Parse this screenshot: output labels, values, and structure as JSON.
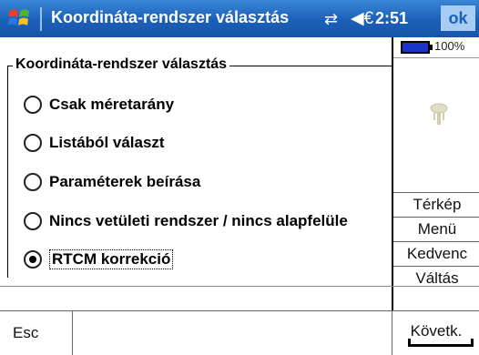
{
  "titlebar": {
    "title": "Koordináta-rendszer választás",
    "time": "2:51",
    "ok_label": "ok",
    "conn_icon": "⇄",
    "vol_icon": "◀€"
  },
  "status": {
    "battery_percent": "100%"
  },
  "group": {
    "title": "Koordináta-rendszer választás",
    "options": [
      {
        "label": "Csak méretarány",
        "selected": false
      },
      {
        "label": "Listából választ",
        "selected": false
      },
      {
        "label": "Paraméterek beírása",
        "selected": false
      },
      {
        "label": "Nincs vetületi rendszer / nincs alapfelüle",
        "selected": false
      },
      {
        "label": "RTCM korrekció",
        "selected": true
      }
    ]
  },
  "sidebar": {
    "buttons": [
      "Térkép",
      "Menü",
      "Kedvenc",
      "Váltás"
    ]
  },
  "bottom": {
    "left_label": "Esc",
    "right_label": "Követk."
  },
  "colors": {
    "titlebar": "#1b5fb8",
    "battery": "#1b34c9"
  }
}
